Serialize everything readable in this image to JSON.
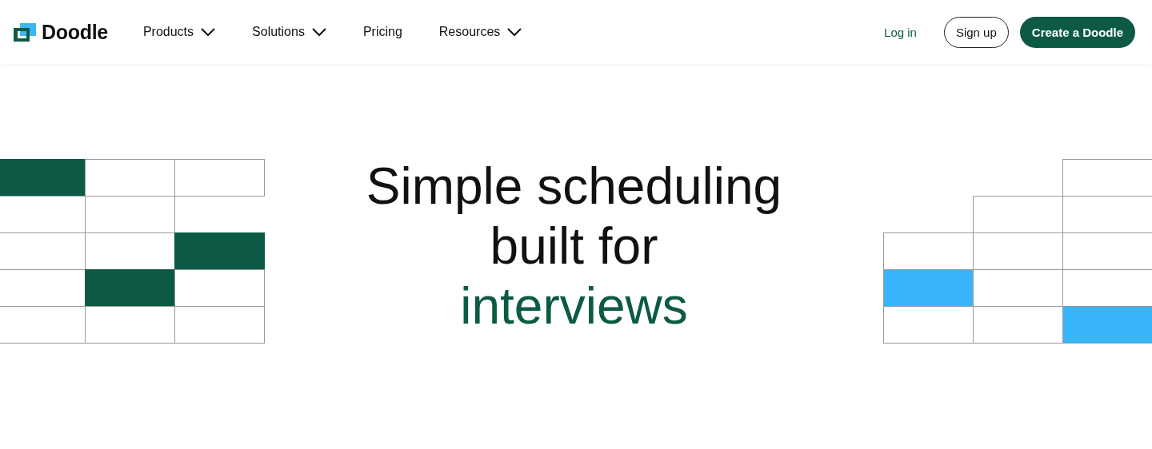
{
  "header": {
    "logo": "Doodle",
    "nav": [
      {
        "label": "Products",
        "dropdown": true
      },
      {
        "label": "Solutions",
        "dropdown": true
      },
      {
        "label": "Pricing",
        "dropdown": false
      },
      {
        "label": "Resources",
        "dropdown": true
      }
    ],
    "login": "Log in",
    "signup": "Sign up",
    "cta": "Create a Doodle"
  },
  "hero": {
    "lines": [
      "Simple scheduling",
      "built for"
    ],
    "highlight": "interviews"
  }
}
